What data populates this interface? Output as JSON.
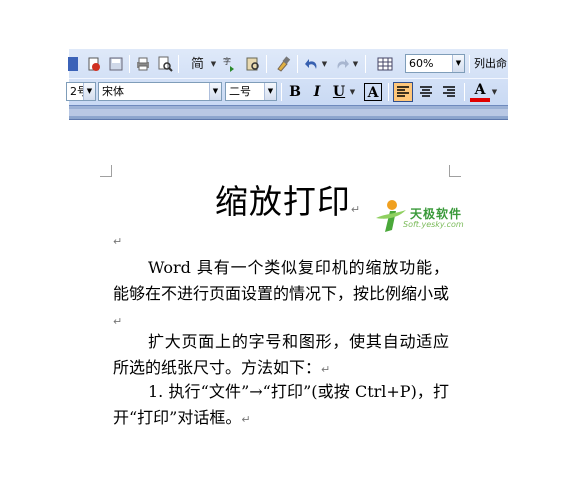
{
  "toolbar": {
    "zoom": "60%",
    "show_list_label": "列出命",
    "style_partial": "2号",
    "font": "宋体",
    "size": "二号",
    "bold_label": "B",
    "italic_label": "I",
    "underline_label": "U",
    "charborder_label": "A",
    "fontcolor_label": "A",
    "fontcolor_hex": "#e00000",
    "icons": [
      "new-doc-icon",
      "permission-icon",
      "save-icon",
      "print-icon",
      "print-preview-icon",
      "spelling-icon",
      "research-icon",
      "format-painter-icon",
      "undo-icon",
      "redo-icon",
      "table-icon",
      "align-left-icon",
      "align-center-icon",
      "align-right-icon"
    ]
  },
  "document": {
    "title": "缩放打印",
    "paragraph_mark": "↵",
    "paragraphs": [
      "Word 具有一个类似复印机的缩放功能，能够在不进行页面设置的情况下，按比例缩小或",
      "扩大页面上的字号和图形，使其自动适应所选的纸张尺寸。方法如下：",
      "1. 执行“文件”→“打印”(或按 Ctrl+P)，打开“打印”对话框。"
    ]
  },
  "watermark": {
    "name": "天极软件",
    "url": "Soft.yesky.com",
    "accent_hex": "#3a9a3a"
  }
}
